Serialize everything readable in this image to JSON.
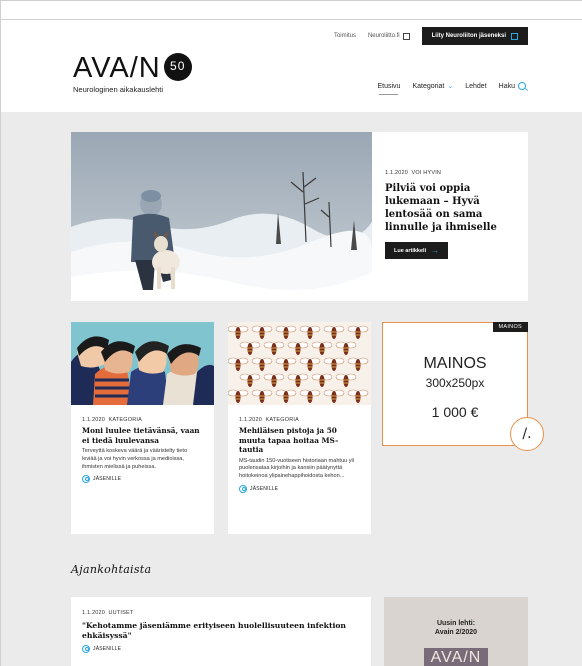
{
  "utility": {
    "link1": "Toimitus",
    "link2": "Neuroliitto.fi",
    "join": "Liity Neuroliiton jäseneksi"
  },
  "logo": {
    "name": "AVA/N",
    "badge": "50",
    "subtitle": "Neurologinen aikakauslehti"
  },
  "nav": {
    "home": "Etusivu",
    "categories": "Kategoriat",
    "magazines": "Lehdet",
    "search": "Haku"
  },
  "hero": {
    "date": "1.1.2020",
    "category": "VOI HYVIN",
    "title": "Pilviä voi oppia lukemaan – Hyvä lentosää on sama linnulle ja ihmiselle",
    "button": "Lue artikkeli"
  },
  "cards": [
    {
      "date": "1.1.2020",
      "category": "KATEGORIA",
      "title": "Moni luulee tietävänsä, vaan ei tiedä luulevansa",
      "desc": "Terveyttä koskeva väärä ja vääristelty tieto leviää ja voi hyvin verkossa ja medioissa, ihmisten mielissä ja puheissa.",
      "member": "JÄSENILLE"
    },
    {
      "date": "1.1.2020",
      "category": "KATEGORIA",
      "title": "Mehiläisen pistoja ja 50 muuta tapaa hoitaa MS-tautia",
      "desc": "MS-taudin 150-vuotiseen historiaan mahtuu yli puolensataa kirjoihin ja kansiin päätynyttä hoitokeinoa ylipainehappihoidosta kehon...",
      "member": "JÄSENILLE"
    }
  ],
  "ad": {
    "tag": "MAINOS",
    "main": "MAINOS",
    "size": "300x250px",
    "price": "1 000 €"
  },
  "section": {
    "heading": "Ajankohtaista"
  },
  "news": {
    "date": "1.1.2020",
    "category": "UUTISET",
    "title": "\"Kehotamme jäseniämme erityiseen huolellisuuteen infektion ehkäisyssä\"",
    "member": "JÄSENILLE"
  },
  "magazine": {
    "title": "Uusin lehti:",
    "issue": "Avain 2/2020",
    "cover_text": "AVA/N"
  }
}
